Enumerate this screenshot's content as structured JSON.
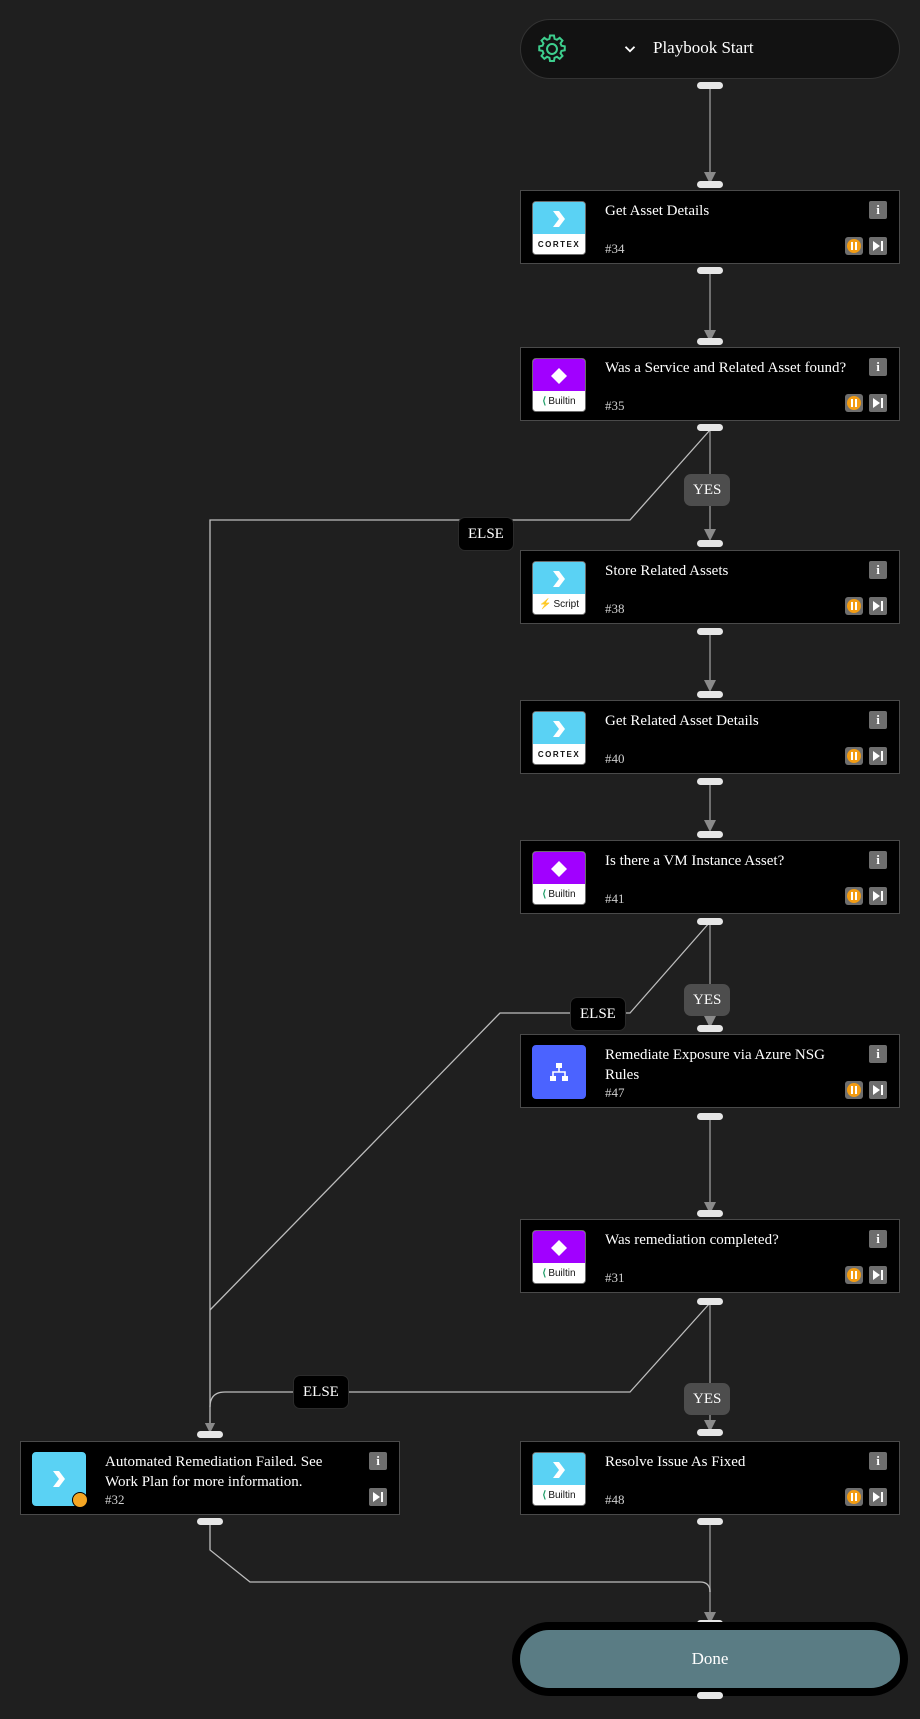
{
  "start": {
    "title": "Playbook Start",
    "icon": "gear-icon",
    "accent": "#3ecf8e"
  },
  "tasks": [
    {
      "id": "t34",
      "title": "Get Asset Details",
      "num": "#34",
      "icon_type": "cortex",
      "icon_label": "CORTEX"
    },
    {
      "id": "t35",
      "title": "Was a Service and Related Asset found?",
      "num": "#35",
      "icon_type": "builtin",
      "icon_label": "Builtin"
    },
    {
      "id": "t38",
      "title": "Store Related Assets",
      "num": "#38",
      "icon_type": "script",
      "icon_label": "Script"
    },
    {
      "id": "t40",
      "title": "Get Related Asset Details",
      "num": "#40",
      "icon_type": "cortex",
      "icon_label": "CORTEX"
    },
    {
      "id": "t41",
      "title": "Is there a VM Instance Asset?",
      "num": "#41",
      "icon_type": "builtin",
      "icon_label": "Builtin"
    },
    {
      "id": "t47",
      "title": "Remediate Exposure via Azure NSG Rules",
      "num": "#47",
      "icon_type": "subplaybook",
      "icon_label": ""
    },
    {
      "id": "t31",
      "title": "Was remediation completed?",
      "num": "#31",
      "icon_type": "builtin",
      "icon_label": "Builtin"
    },
    {
      "id": "t48",
      "title": "Resolve Issue As Fixed",
      "num": "#48",
      "icon_type": "builtin",
      "icon_label": "Builtin"
    },
    {
      "id": "t32",
      "title": "Automated Remediation Failed. See Work Plan for more information.",
      "num": "#32",
      "icon_type": "manual",
      "icon_label": ""
    }
  ],
  "branches": {
    "yes_label": "YES",
    "else_label": "ELSE"
  },
  "done": {
    "title": "Done"
  },
  "colors": {
    "background": "#1f1f1f",
    "node": "#000000",
    "cyan": "#5ad2f4",
    "purple": "#a100ff",
    "subplaybook": "#4b63ff",
    "breakpoint": "#f39c12",
    "done": "#5a7c84",
    "edge": "#8a8a8a"
  }
}
